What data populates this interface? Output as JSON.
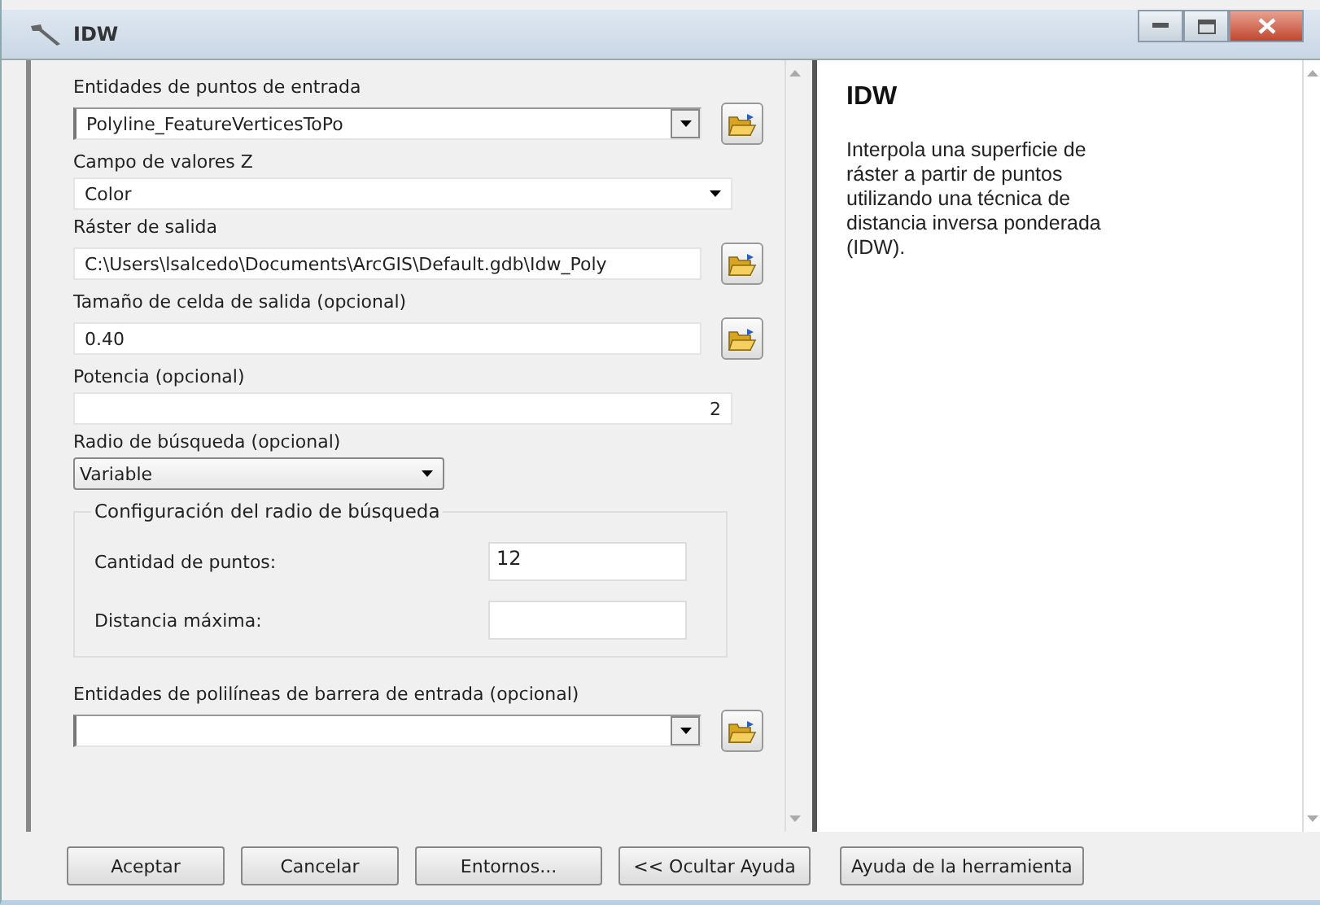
{
  "window": {
    "title": "IDW"
  },
  "parameters": [
    {
      "label": "Entidades de puntos de entrada",
      "kind": "combo",
      "value": "Polyline_FeatureVerticesToPo",
      "browse": true
    },
    {
      "label": "Campo de valores Z",
      "kind": "dropdown",
      "value": "Color",
      "browse": false
    },
    {
      "label": "Ráster de salida",
      "kind": "text",
      "value": "C:\\Users\\lsalcedo\\Documents\\ArcGIS\\Default.gdb\\Idw_Poly",
      "browse": true
    },
    {
      "label": "Tamaño de celda de salida (opcional)",
      "kind": "text",
      "value": "0.40",
      "browse": true
    },
    {
      "label": "Potencia (opcional)",
      "kind": "number",
      "value": "2",
      "browse": false
    },
    {
      "label": "Radio de búsqueda (opcional)",
      "kind": "short_dropdown",
      "value": "Variable",
      "browse": false,
      "group": {
        "title": "Configuración del radio de búsqueda",
        "fields": [
          {
            "label": "Cantidad de puntos:",
            "value": "12"
          },
          {
            "label": "Distancia máxima:"
          }
        ]
      }
    },
    {
      "label": "Entidades de polilíneas de barrera de entrada (opcional)",
      "kind": "combo",
      "browse": true
    }
  ],
  "help": {
    "title": "IDW",
    "text": "Interpola una superficie de ráster a partir de puntos utilizando una técnica de distancia inversa ponderada (IDW)."
  },
  "buttons": [
    "Aceptar",
    "Cancelar",
    "Entornos...",
    "<< Ocultar Ayuda",
    "Ayuda de la herramienta"
  ]
}
